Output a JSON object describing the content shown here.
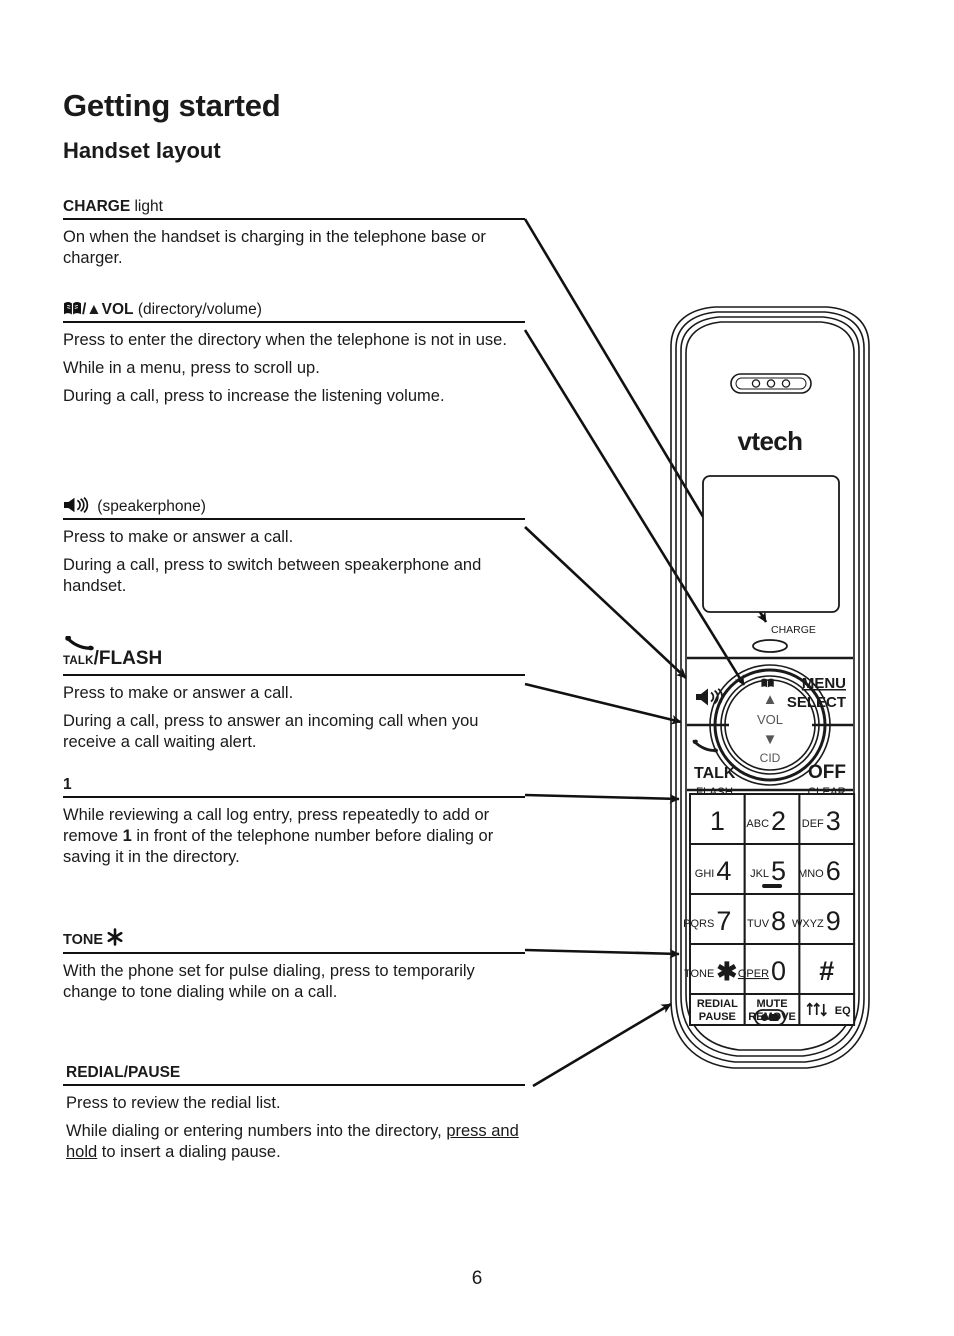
{
  "page": {
    "title": "Getting started",
    "section": "Handset layout",
    "number": "6"
  },
  "features": [
    {
      "id": "charge-light",
      "head_icon": "",
      "head_bold": "CHARGE",
      "head_regular": " light",
      "paragraphs": [
        "On when the handset is charging in the telephone base or charger."
      ]
    },
    {
      "id": "directory-volume",
      "head_icon": "book-icon",
      "head_bold": "/▲VOL",
      "head_regular": " (directory/volume)",
      "paragraphs": [
        "Press to enter the directory when the telephone is not in use.",
        "While in a menu, press to scroll up.",
        "During a call, press to increase the listening volume."
      ]
    },
    {
      "id": "speakerphone",
      "head_icon": "speaker-icon",
      "head_bold": "",
      "head_regular": " (speakerphone)",
      "paragraphs": [
        "Press to make or answer a call.",
        "During a call, press to switch between speakerphone and handset."
      ]
    },
    {
      "id": "talk-flash",
      "head_icon": "talk-handset-icon",
      "head_small": "TALK",
      "head_bold": "/FLASH",
      "head_regular": "",
      "paragraphs": [
        "Press to make or answer a call.",
        "During a call, press to answer an incoming call when you receive a call waiting alert."
      ]
    },
    {
      "id": "key-one",
      "head_icon": "",
      "head_bold": "1",
      "head_regular": "",
      "paragraphs": [
        "While reviewing a call log entry, press repeatedly to add or remove 1 in front of the telephone number before dialing or saving it in the directory."
      ]
    },
    {
      "id": "tone-star",
      "head_icon": "star-icon",
      "head_bold": "TONE ",
      "head_regular": "",
      "paragraphs": [
        "With the phone set for pulse dialing, press to temporarily change to tone dialing while on a call."
      ]
    },
    {
      "id": "redial-pause",
      "head_icon": "",
      "head_bold": "REDIAL/PAUSE",
      "head_regular": "",
      "paragraphs": [
        "Press to review the redial list.",
        "While dialing or entering numbers into the directory, press and hold to insert a dialing pause."
      ]
    }
  ],
  "handset": {
    "brand": "vtech",
    "charge_label": "CHARGE",
    "nav": {
      "directory_icon": "book-icon",
      "up_arrow": "▲",
      "vol_label": "VOL",
      "down_arrow": "▼",
      "cid_label": "CID"
    },
    "soft_keys": {
      "menu": "MENU",
      "select": "SELECT",
      "off": "OFF",
      "clear": "CLEAR",
      "talk": "TALK",
      "flash": "FLASH",
      "speaker_icon": "speaker-icon"
    },
    "keypad": [
      {
        "letters": "",
        "digit": "1"
      },
      {
        "letters": "ABC",
        "digit": "2"
      },
      {
        "letters": "DEF",
        "digit": "3"
      },
      {
        "letters": "GHI",
        "digit": "4"
      },
      {
        "letters": "JKL",
        "digit": "5"
      },
      {
        "letters": "MNO",
        "digit": "6"
      },
      {
        "letters": "PQRS",
        "digit": "7"
      },
      {
        "letters": "TUV",
        "digit": "8"
      },
      {
        "letters": "WXYZ",
        "digit": "9"
      },
      {
        "letters": "TONE",
        "digit": "✱"
      },
      {
        "letters": "OPER",
        "digit": "0"
      },
      {
        "letters": "",
        "digit": "#"
      }
    ],
    "bottom_keys": [
      {
        "line1": "REDIAL",
        "line2": "PAUSE"
      },
      {
        "line1": "MUTE",
        "line2": "REMOVE"
      },
      {
        "line1": "EQ",
        "line2": ""
      }
    ]
  }
}
